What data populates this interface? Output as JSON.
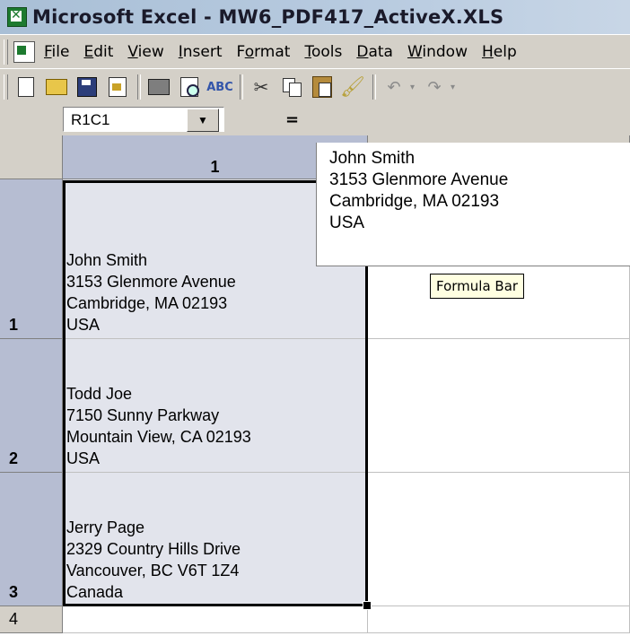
{
  "window": {
    "title": "Microsoft Excel - MW6_PDF417_ActiveX.XLS"
  },
  "menu": [
    {
      "name": "menu-file",
      "pre": "",
      "ul": "F",
      "post": "ile"
    },
    {
      "name": "menu-edit",
      "pre": "",
      "ul": "E",
      "post": "dit"
    },
    {
      "name": "menu-view",
      "pre": "",
      "ul": "V",
      "post": "iew"
    },
    {
      "name": "menu-insert",
      "pre": "",
      "ul": "I",
      "post": "nsert"
    },
    {
      "name": "menu-format",
      "pre": "F",
      "ul": "o",
      "post": "rmat"
    },
    {
      "name": "menu-tools",
      "pre": "",
      "ul": "T",
      "post": "ools"
    },
    {
      "name": "menu-data",
      "pre": "",
      "ul": "D",
      "post": "ata"
    },
    {
      "name": "menu-window",
      "pre": "",
      "ul": "W",
      "post": "indow"
    },
    {
      "name": "menu-help",
      "pre": "",
      "ul": "H",
      "post": "elp"
    }
  ],
  "toolbar": {
    "icons": [
      "new-icon",
      "open-icon",
      "save-icon",
      "permission-icon",
      "print-icon",
      "print-preview-icon",
      "spelling-icon",
      "cut-icon",
      "copy-icon",
      "paste-icon",
      "format-painter-icon",
      "undo-icon",
      "redo-icon"
    ],
    "spell_text": "ABC",
    "cut_glyph": "✂",
    "brush_glyph": "🖌",
    "undo_glyph": "↶",
    "redo_glyph": "↷",
    "dropdown_glyph": "▾"
  },
  "formula_bar": {
    "name_box": "R1C1",
    "name_dropdown": "▼",
    "equals": "=",
    "content": "John Smith\n3153 Glenmore Avenue\nCambridge, MA 02193\nUSA",
    "tooltip": "Formula Bar"
  },
  "sheet": {
    "columns": [
      {
        "label": "1",
        "selected": true
      },
      {
        "label": "",
        "selected": false
      }
    ],
    "rows": [
      {
        "label": "1",
        "selected": true,
        "cells": [
          "John Smith\n3153 Glenmore Avenue\nCambridge, MA 02193\nUSA",
          ""
        ]
      },
      {
        "label": "2",
        "selected": true,
        "cells": [
          "Todd Joe\n7150 Sunny Parkway\nMountain View, CA 02193\nUSA",
          ""
        ]
      },
      {
        "label": "3",
        "selected": true,
        "cells": [
          "Jerry Page\n2329 Country Hills Drive\nVancouver, BC V6T 1Z4\nCanada",
          ""
        ]
      },
      {
        "label": "4",
        "selected": false,
        "cells": [
          "",
          ""
        ]
      }
    ]
  }
}
